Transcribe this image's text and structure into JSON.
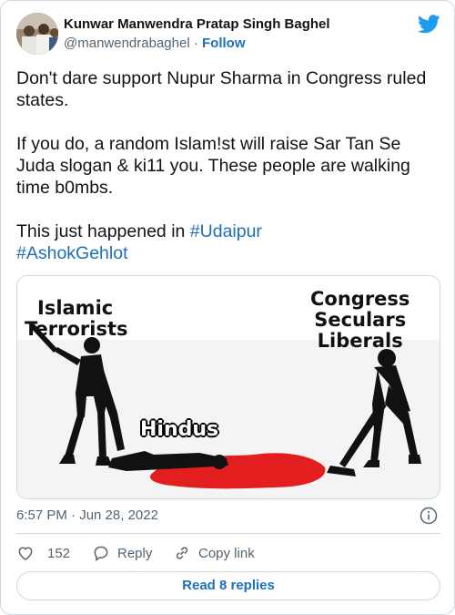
{
  "author": {
    "display_name": "Kunwar Manwendra Pratap Singh Baghel",
    "handle": "@manwendrabaghel",
    "separator": "·",
    "follow_label": "Follow"
  },
  "tweet": {
    "line1": "Don't dare support Nupur Sharma in Congress ruled states.",
    "line2": "If you do, a random Islam!st will raise Sar Tan Se Juda slogan & ki11 you. These people are walking time b0mbs.",
    "line3_prefix": "This just happened in ",
    "hashtag1": "#Udaipur",
    "hashtag2": "#AshokGehlot"
  },
  "media": {
    "label_left_line1": "Islamic",
    "label_left_line2": "Terrorists",
    "label_right_line1": "Congress",
    "label_right_line2": "Seculars",
    "label_right_line3": "Liberals",
    "label_center": "Hindus"
  },
  "meta": {
    "timestamp": "6:57 PM · Jun 28, 2022"
  },
  "actions": {
    "like_count": "152",
    "reply_label": "Reply",
    "copy_label": "Copy link",
    "read_replies_label": "Read 8 replies"
  },
  "colors": {
    "accent": "#1d9bf0",
    "link": "#1d6fb8",
    "muted": "#536471",
    "border": "#cfd9de",
    "blood": "#e31e1e"
  }
}
